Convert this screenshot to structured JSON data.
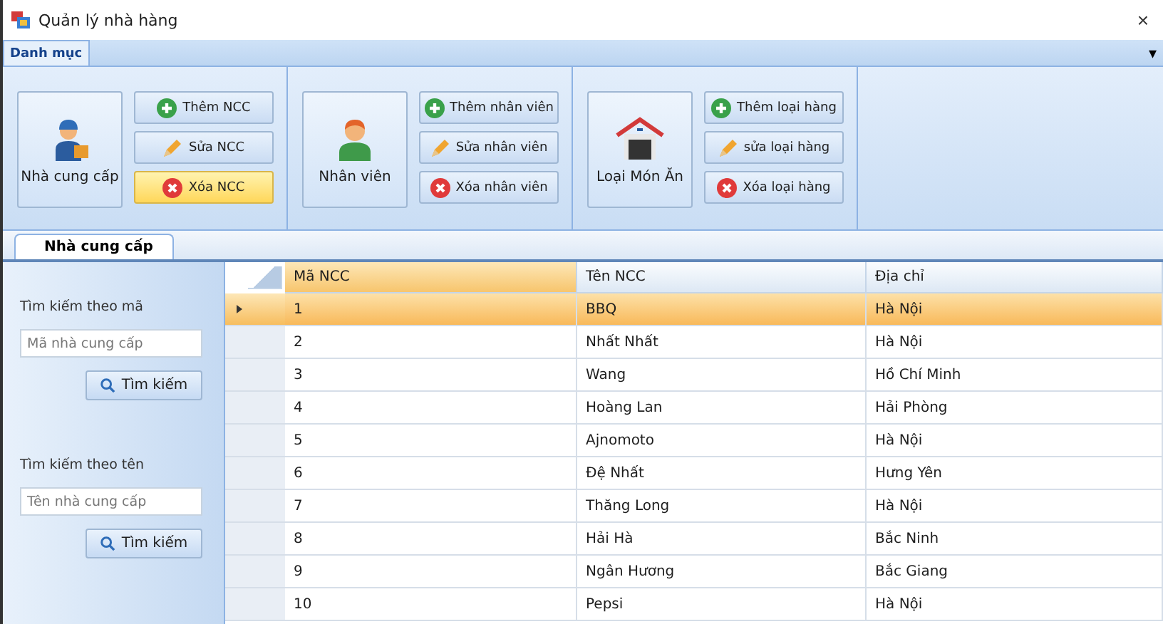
{
  "window": {
    "title": "Quản lý nhà hàng",
    "close": "×"
  },
  "ribbon": {
    "tabs": [
      {
        "label": "Danh mục",
        "selected": true
      }
    ],
    "collapse": "▾",
    "groups": [
      {
        "main": {
          "label": "Nhà cung cấp"
        },
        "actions": [
          {
            "label": "Thêm NCC",
            "kind": "add",
            "highlighted": false
          },
          {
            "label": "Sửa NCC",
            "kind": "edit",
            "highlighted": false
          },
          {
            "label": "Xóa NCC",
            "kind": "delete",
            "highlighted": true
          }
        ]
      },
      {
        "main": {
          "label": "Nhân viên"
        },
        "actions": [
          {
            "label": "Thêm nhân viên",
            "kind": "add",
            "highlighted": false
          },
          {
            "label": "Sửa nhân viên",
            "kind": "edit",
            "highlighted": false
          },
          {
            "label": "Xóa nhân viên",
            "kind": "delete",
            "highlighted": false
          }
        ]
      },
      {
        "main": {
          "label": "Loại Món Ăn"
        },
        "actions": [
          {
            "label": "Thêm loại hàng",
            "kind": "add",
            "highlighted": false
          },
          {
            "label": "sửa loại hàng",
            "kind": "edit",
            "highlighted": false
          },
          {
            "label": "Xóa loại hàng",
            "kind": "delete",
            "highlighted": false
          }
        ]
      }
    ]
  },
  "document_tabs": [
    {
      "label": "Nhà cung cấp",
      "selected": true
    }
  ],
  "search": [
    {
      "label": "Tìm kiếm theo mã",
      "placeholder": "Mã nhà cung cấp",
      "button": "Tìm kiếm"
    },
    {
      "label": "Tìm kiếm theo tên",
      "placeholder": "Tên nhà cung cấp",
      "button": "Tìm kiếm"
    }
  ],
  "table": {
    "columns": [
      "Mã NCC",
      "Tên NCC",
      "Địa chỉ"
    ],
    "rows": [
      {
        "cells": [
          "1",
          "BBQ",
          "Hà Nội"
        ],
        "selected": true
      },
      {
        "cells": [
          "2",
          "Nhất Nhất",
          "Hà Nội"
        ],
        "selected": false
      },
      {
        "cells": [
          "3",
          "Wang",
          "Hồ Chí Minh"
        ],
        "selected": false
      },
      {
        "cells": [
          "4",
          "Hoàng Lan",
          "Hải Phòng"
        ],
        "selected": false
      },
      {
        "cells": [
          "5",
          "Ajnomoto",
          "Hà Nội"
        ],
        "selected": false
      },
      {
        "cells": [
          "6",
          "Đệ Nhất",
          "Hưng Yên"
        ],
        "selected": false
      },
      {
        "cells": [
          "7",
          "Thăng Long",
          "Hà Nội"
        ],
        "selected": false
      },
      {
        "cells": [
          "8",
          "Hải Hà",
          "Bắc Ninh"
        ],
        "selected": false
      },
      {
        "cells": [
          "9",
          "Ngân Hương",
          "Bắc Giang"
        ],
        "selected": false
      },
      {
        "cells": [
          "10",
          "Pepsi",
          "Hà Nội"
        ],
        "selected": false
      }
    ]
  }
}
